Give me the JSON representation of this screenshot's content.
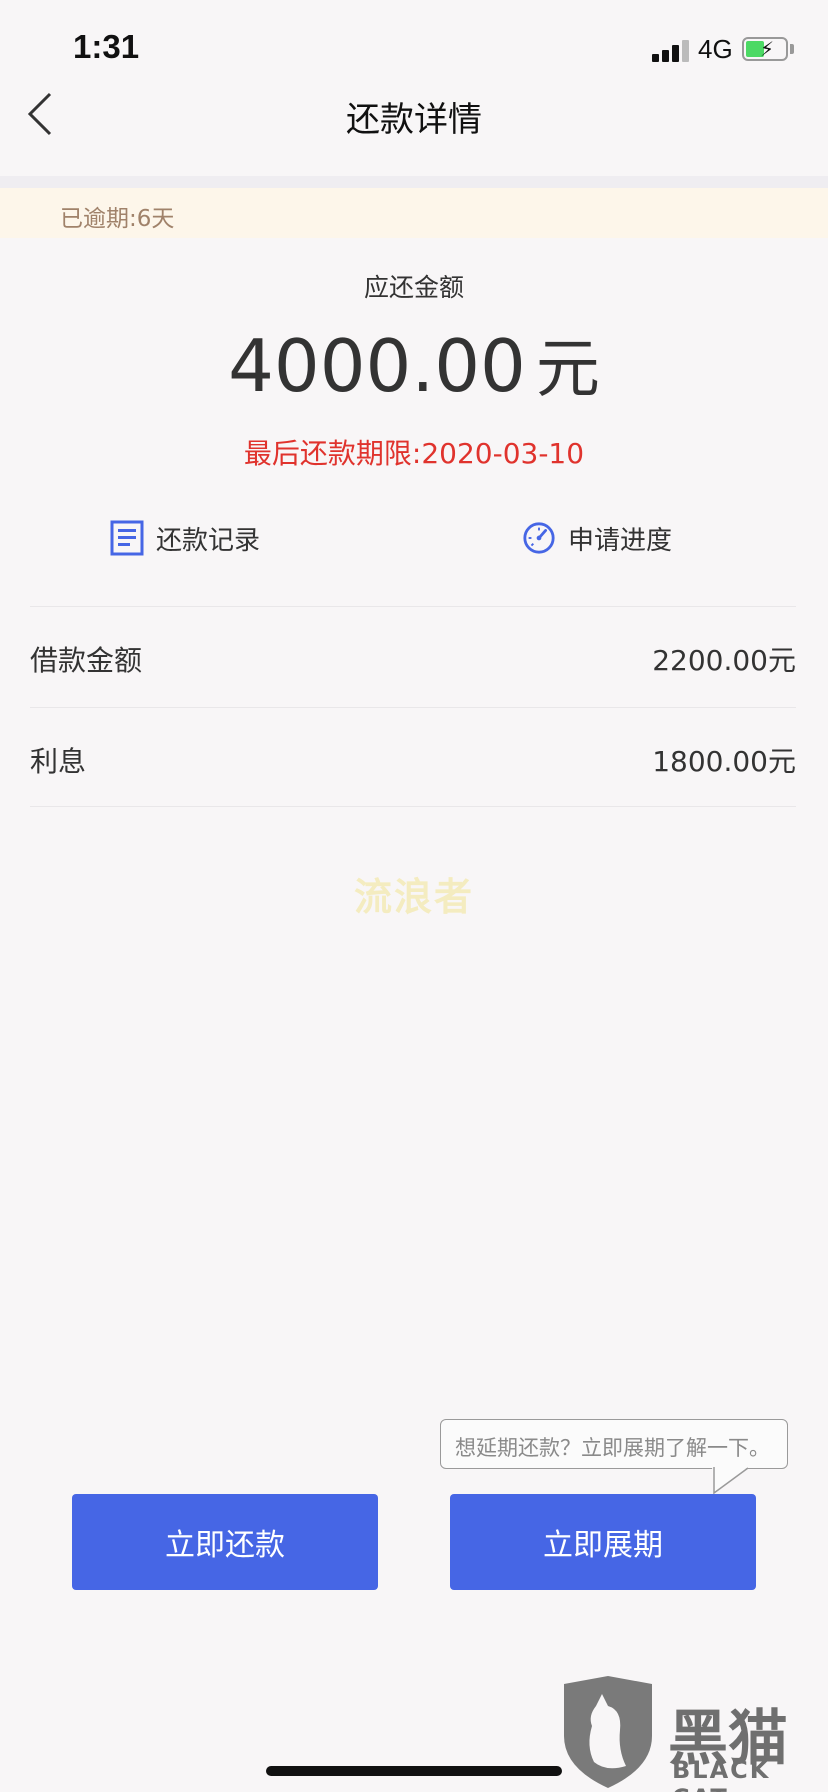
{
  "status_bar": {
    "time": "1:31",
    "network": "4G"
  },
  "nav": {
    "title": "还款详情",
    "back_icon": "chevron-left-icon"
  },
  "overdue": {
    "text": "已逾期:6天"
  },
  "summary": {
    "label": "应还金额",
    "amount": "4000.00",
    "unit": "元",
    "deadline": "最后还款期限:2020-03-10"
  },
  "actions": [
    {
      "label": "还款记录",
      "icon": "document-icon"
    },
    {
      "label": "申请进度",
      "icon": "gauge-icon"
    }
  ],
  "details": [
    {
      "label": "借款金额",
      "value": "2200.00元"
    },
    {
      "label": "利息",
      "value": "1800.00元"
    }
  ],
  "watermark": "流浪者",
  "tooltip": "想延期还款？立即展期了解一下。",
  "buttons": {
    "repay": "立即还款",
    "extend": "立即展期"
  },
  "brand": {
    "name": "黑猫",
    "sub": "BLACK CAT"
  },
  "colors": {
    "accent": "#4666e5",
    "deadline": "#e0332d",
    "overdue_bg": "#fdf6ea",
    "overdue_text": "#a0826a"
  }
}
